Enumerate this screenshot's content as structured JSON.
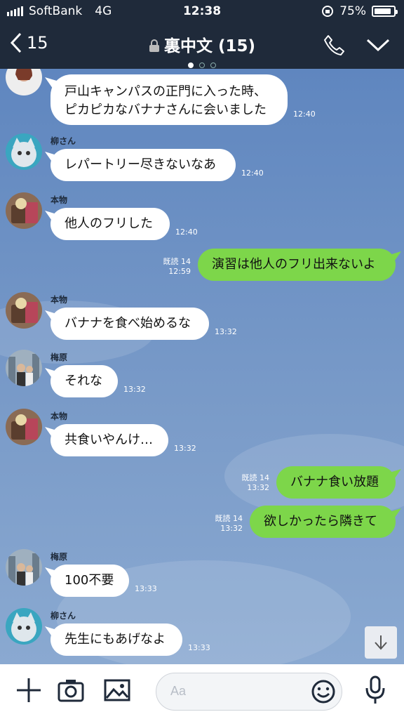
{
  "status": {
    "carrier": "SoftBank",
    "network": "4G",
    "time": "12:38",
    "battery": "75%",
    "battery_level": 0.75
  },
  "header": {
    "back_count": "15",
    "title": "裏中文 (15)"
  },
  "messages": [
    {
      "text": "戸山キャンパスの正門に入った時、ピカピカなバナナさんに会いました",
      "time": "12:40"
    },
    {
      "sender": "柳さん",
      "text": "レパートリー尽きないなあ",
      "time": "12:40"
    },
    {
      "sender": "本物",
      "text": "他人のフリした",
      "time": "12:40"
    },
    {
      "read": "既読 14",
      "text": "演習は他人のフリ出来ないよ",
      "time": "12:59"
    },
    {
      "sender": "本物",
      "text": "バナナを食べ始めるな",
      "time": "13:32"
    },
    {
      "sender": "梅原",
      "text": "それな",
      "time": "13:32"
    },
    {
      "sender": "本物",
      "text": "共食いやんけ…",
      "time": "13:32"
    },
    {
      "read": "既読 14",
      "text": "バナナ食い放題",
      "time": "13:32"
    },
    {
      "read": "既読 14",
      "text": "欲しかったら隣きて",
      "time": "13:32"
    },
    {
      "sender": "梅原",
      "text": "100不要",
      "time": "13:33"
    },
    {
      "sender": "柳さん",
      "text": "先生にもあげなよ",
      "time": "13:33"
    }
  ],
  "input": {
    "placeholder": "Aa"
  },
  "icons": [
    "back-chevron-icon",
    "lock-icon",
    "phone-icon",
    "chevron-down-icon",
    "scroll-down-icon",
    "plus-icon",
    "camera-icon",
    "image-icon",
    "emoji-icon",
    "mic-icon"
  ],
  "colors": {
    "header": "#1f2a3a",
    "outgoing": "#7dd64a",
    "incoming": "#ffffff",
    "background": "#6f8fbf"
  }
}
